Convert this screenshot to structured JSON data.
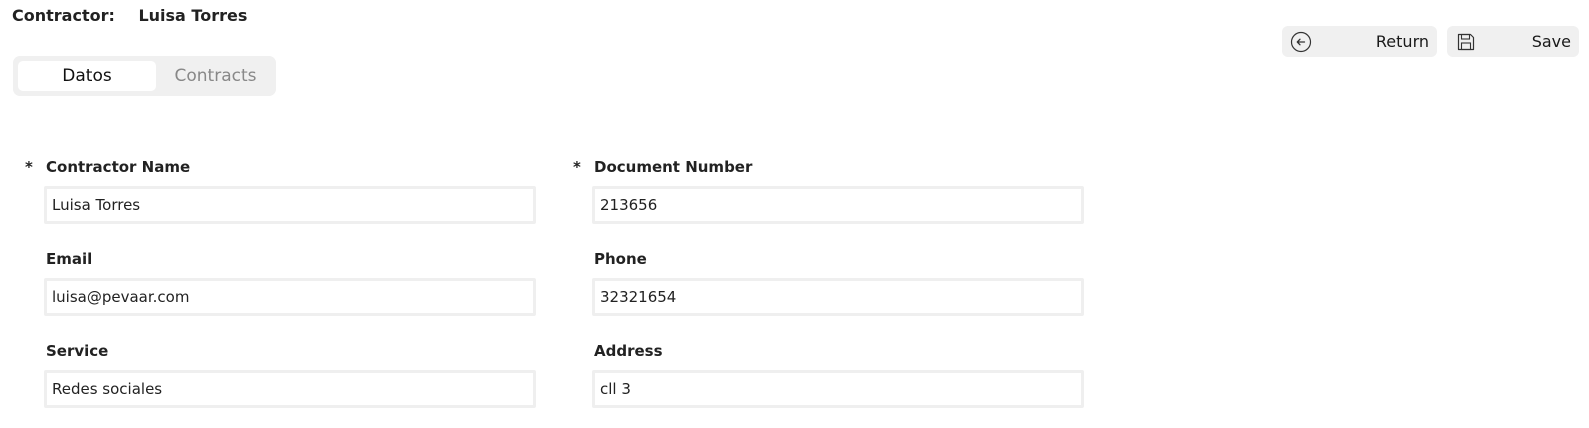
{
  "header": {
    "label": "Contractor:",
    "name": "Luisa Torres"
  },
  "actions": {
    "return_label": "Return",
    "return_icon": "arrow-left-circle-icon",
    "save_label": "Save",
    "save_icon": "floppy-disk-icon"
  },
  "tabs": [
    {
      "label": "Datos",
      "active": true
    },
    {
      "label": "Contracts",
      "active": false
    }
  ],
  "form": {
    "contractor_name": {
      "label": "Contractor Name",
      "required": "*",
      "value": "Luisa Torres"
    },
    "document_number": {
      "label": "Document Number",
      "required": "*",
      "value": "213656"
    },
    "email": {
      "label": "Email",
      "value": "luisa@pevaar.com"
    },
    "phone": {
      "label": "Phone",
      "value": "32321654"
    },
    "service": {
      "label": "Service",
      "value": "Redes sociales"
    },
    "address": {
      "label": "Address",
      "value": "cll 3"
    }
  },
  "colors": {
    "panel_bg": "#f0f0f0",
    "input_border": "#efefef",
    "inactive_tab_text": "#888888"
  }
}
